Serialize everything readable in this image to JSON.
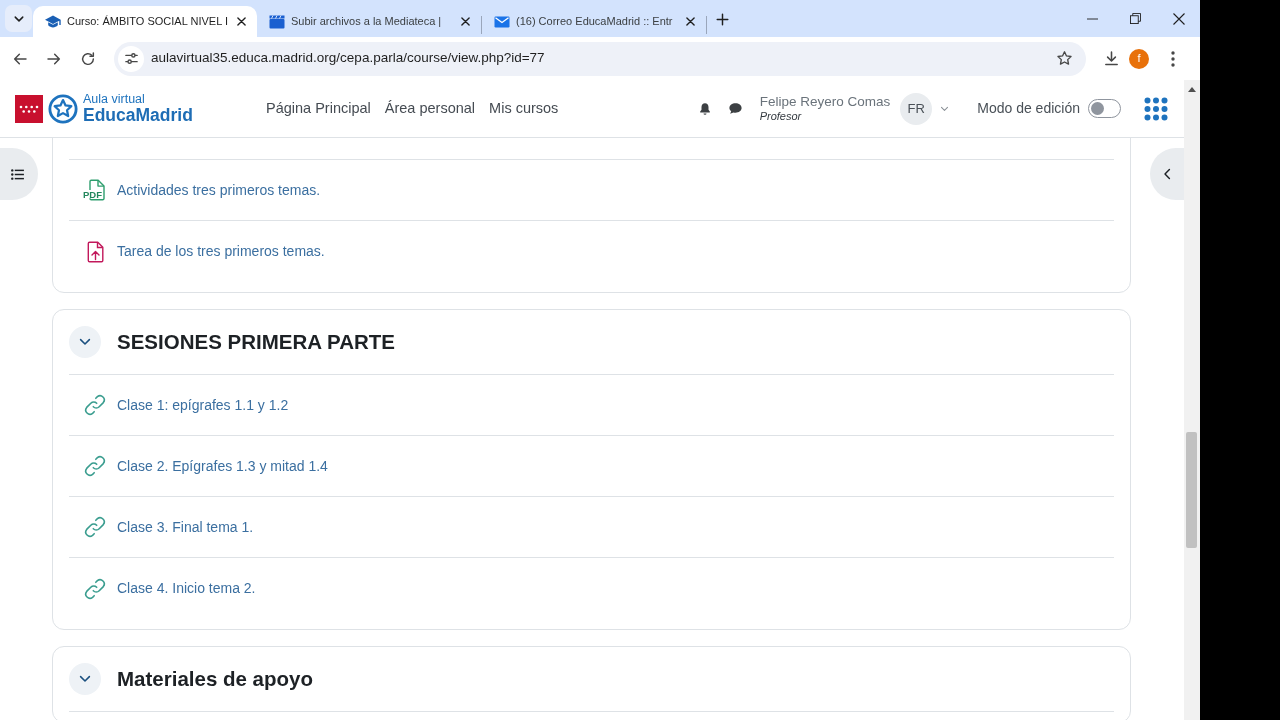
{
  "browser": {
    "tabs": [
      {
        "kind": "course",
        "title": "Curso: ÁMBITO SOCIAL NIVEL I",
        "selected": true
      },
      {
        "kind": "media",
        "title": "Subir archivos a la Mediateca |",
        "selected": false
      },
      {
        "kind": "mail",
        "title": "(16) Correo EducaMadrid :: Entr",
        "selected": false
      }
    ],
    "address_bar": {
      "url": "aulavirtual35.educa.madrid.org/cepa.parla/course/view.php?id=77"
    },
    "profile": {
      "initial": "f"
    }
  },
  "header": {
    "logo": {
      "subtitle": "Aula virtual",
      "name": "EducaMadrid"
    },
    "nav": [
      {
        "label": "Página Principal"
      },
      {
        "label": "Área personal"
      },
      {
        "label": "Mis cursos"
      }
    ],
    "user": {
      "name": "Felipe Reyero Comas",
      "role": "Profesor",
      "initials": "FR"
    },
    "edit_mode": {
      "label": "Modo de edición",
      "on": false
    }
  },
  "sections": [
    {
      "items": [
        {
          "kind": "pdf",
          "icon_label": "PDF",
          "title": "Actividades tres primeros temas."
        },
        {
          "kind": "assignment",
          "title": "Tarea de los tres primeros temas."
        }
      ]
    },
    {
      "title": "SESIONES PRIMERA PARTE",
      "expanded": true,
      "items": [
        {
          "kind": "url",
          "title": "Clase 1: epígrafes 1.1 y 1.2"
        },
        {
          "kind": "url",
          "title": "Clase 2. Epígrafes 1.3 y mitad 1.4"
        },
        {
          "kind": "url",
          "title": "Clase 3. Final tema 1."
        },
        {
          "kind": "url",
          "title": "Clase 4. Inicio tema 2."
        }
      ]
    },
    {
      "title": "Materiales de apoyo",
      "expanded": true
    }
  ]
}
